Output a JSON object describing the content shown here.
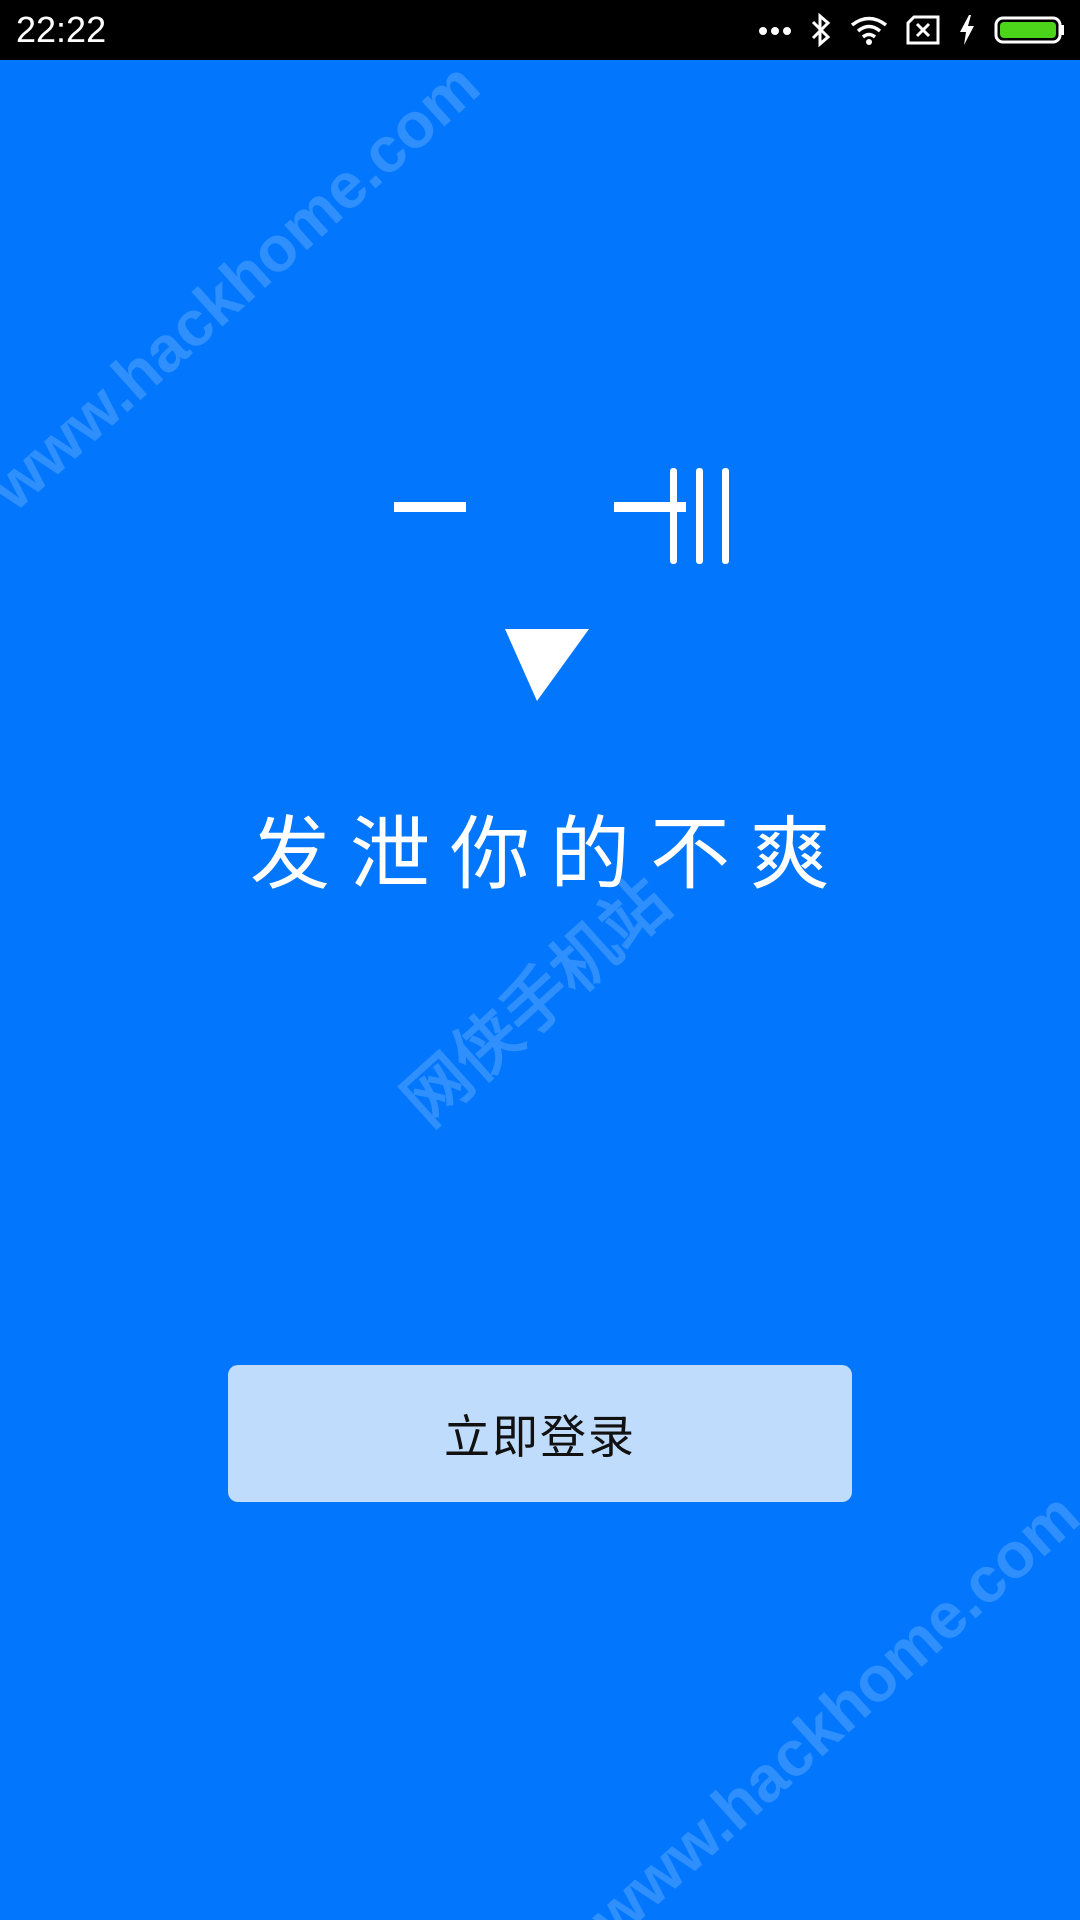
{
  "status_bar": {
    "time": "22:22",
    "icons": [
      "more-dots-icon",
      "bluetooth-icon",
      "wifi-icon",
      "no-sim-icon",
      "charging-bolt-icon",
      "battery-icon"
    ]
  },
  "colors": {
    "background": "#0277fd",
    "button_background": "#bfdcfc",
    "battery_fill": "#4cd41a"
  },
  "logo": {
    "icon": "sad-face-logo-icon"
  },
  "slogan": "发泄你的不爽",
  "login_button": {
    "label": "立即登录"
  },
  "watermarks": [
    "www.hackhome.com",
    "网侠手机站",
    "www.hackhome.com"
  ]
}
